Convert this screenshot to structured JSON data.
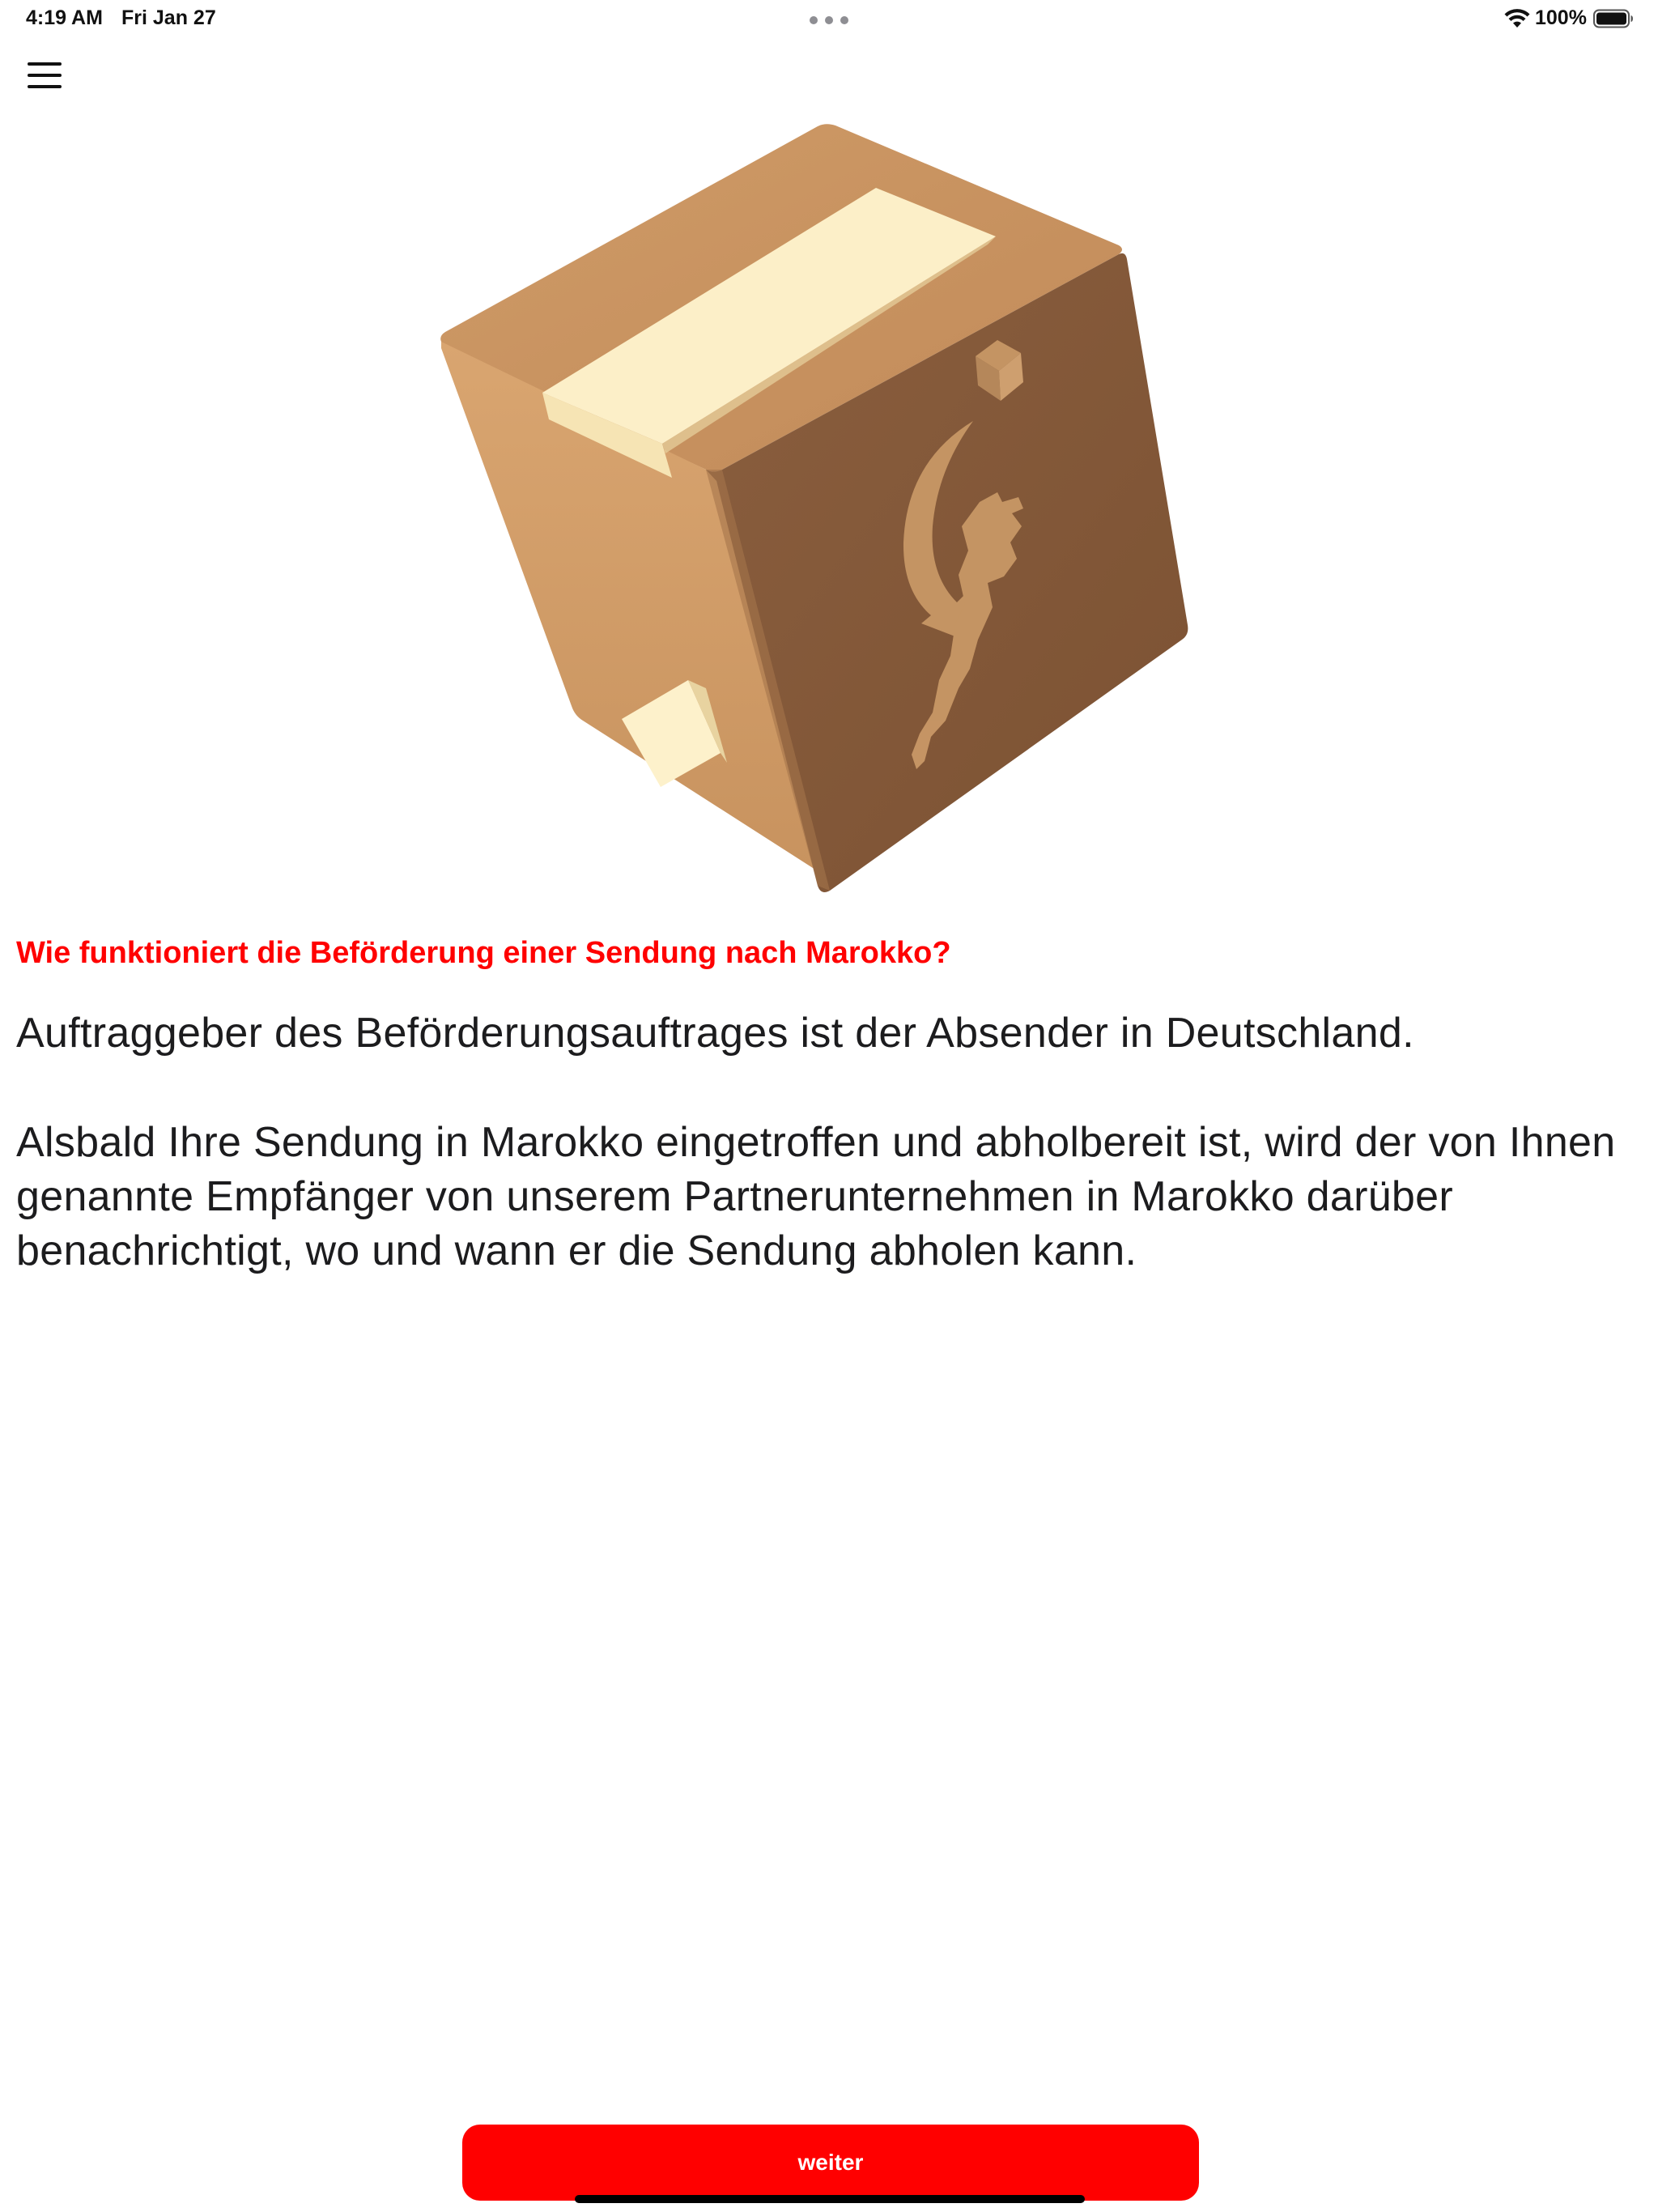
{
  "status_bar": {
    "time": "4:19 AM",
    "date": "Fri Jan 27",
    "battery": "100%"
  },
  "icons": {
    "menu": "hamburger-menu-icon",
    "hero": "moroccan-parcel-box-illustration"
  },
  "content": {
    "heading": "Wie funktioniert die Beförderung einer Sendung nach Marokko?",
    "paragraph_1": "Auftraggeber des Beförderungsauftrages ist der Absender in Deutschland.",
    "paragraph_2": "Alsbald Ihre Sendung in Marokko eingetroffen und abholbereit ist, wird der von Ihnen genannte Empfänger von unserem Partnerunternehmen in Marokko darüber benachrichtigt, wo und wann er die Sendung abholen kann."
  },
  "footer": {
    "next_label": "weiter"
  },
  "colors": {
    "accent": "#ff0000",
    "text": "#1c1c1e",
    "background": "#ffffff"
  }
}
